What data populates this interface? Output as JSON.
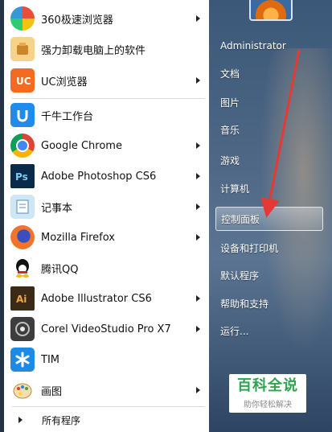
{
  "programs": [
    {
      "label": "360极速浏览器",
      "icon": "360-browser-icon",
      "color": "#7bc043",
      "arrow": true
    },
    {
      "label": "强力卸载电脑上的软件",
      "icon": "uninstaller-icon",
      "color": "#f7b32b",
      "arrow": false
    },
    {
      "label": "UC浏览器",
      "icon": "uc-browser-icon",
      "color": "#f26b21",
      "arrow": true
    },
    {
      "label": "千牛工作台",
      "icon": "qianniu-icon",
      "color": "#1f8ceb",
      "arrow": false
    },
    {
      "label": "Google Chrome",
      "icon": "chrome-icon",
      "color": "#db4437",
      "arrow": true
    },
    {
      "label": "Adobe Photoshop CS6",
      "icon": "photoshop-icon",
      "color": "#0b2a4a",
      "arrow": true
    },
    {
      "label": "记事本",
      "icon": "notepad-icon",
      "color": "#6fb3e0",
      "arrow": true
    },
    {
      "label": "Mozilla Firefox",
      "icon": "firefox-icon",
      "color": "#f0742b",
      "arrow": true
    },
    {
      "label": "腾讯QQ",
      "icon": "qq-icon",
      "color": "#111111",
      "arrow": false
    },
    {
      "label": "Adobe Illustrator CS6",
      "icon": "illustrator-icon",
      "color": "#3a2a16",
      "arrow": true
    },
    {
      "label": "Corel VideoStudio Pro X7",
      "icon": "videostudio-icon",
      "color": "#5a5a5a",
      "arrow": true
    },
    {
      "label": "TIM",
      "icon": "tim-icon",
      "color": "#1d8be6",
      "arrow": false
    },
    {
      "label": "画图",
      "icon": "paint-icon",
      "color": "#e0a040",
      "arrow": true
    }
  ],
  "all_programs": "所有程序",
  "right_items": [
    {
      "label": "Administrator",
      "name": "user-name-link",
      "selected": false
    },
    {
      "label": "文档",
      "name": "documents-link",
      "selected": false
    },
    {
      "label": "图片",
      "name": "pictures-link",
      "selected": false
    },
    {
      "label": "音乐",
      "name": "music-link",
      "selected": false
    },
    {
      "label": "游戏",
      "name": "games-link",
      "selected": false
    },
    {
      "label": "计算机",
      "name": "computer-link",
      "selected": false
    },
    {
      "label": "控制面板",
      "name": "control-panel-link",
      "selected": true
    },
    {
      "label": "设备和打印机",
      "name": "devices-printers-link",
      "selected": false
    },
    {
      "label": "默认程序",
      "name": "default-programs-link",
      "selected": false
    },
    {
      "label": "帮助和支持",
      "name": "help-support-link",
      "selected": false
    },
    {
      "label": "运行...",
      "name": "run-link",
      "selected": false
    }
  ],
  "watermark": {
    "main": "百科全说",
    "sub": "助你轻松解决"
  },
  "colors": {
    "annotation_arrow": "#e53935",
    "watermark_green": "#2ea44f"
  }
}
